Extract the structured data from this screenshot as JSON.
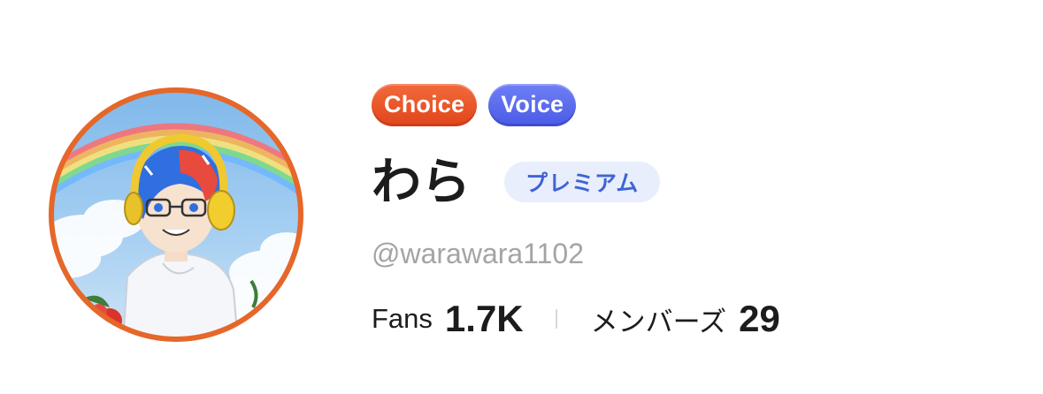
{
  "profile": {
    "avatar_description": "avatar",
    "badges": [
      {
        "label": "Choice",
        "color": "#e5501f"
      },
      {
        "label": "Voice",
        "color": "#5565ec"
      }
    ],
    "display_name": "わら",
    "premium_label": "プレミアム",
    "handle": "@warawara1102",
    "stats": {
      "fans_label": "Fans",
      "fans_value": "1.7K",
      "members_label": "メンバーズ",
      "members_value": "29"
    }
  },
  "colors": {
    "avatar_ring": "#e5672a",
    "premium_bg": "#e8eefb",
    "premium_text": "#3f64d6",
    "handle_text": "#a4a4a8"
  }
}
